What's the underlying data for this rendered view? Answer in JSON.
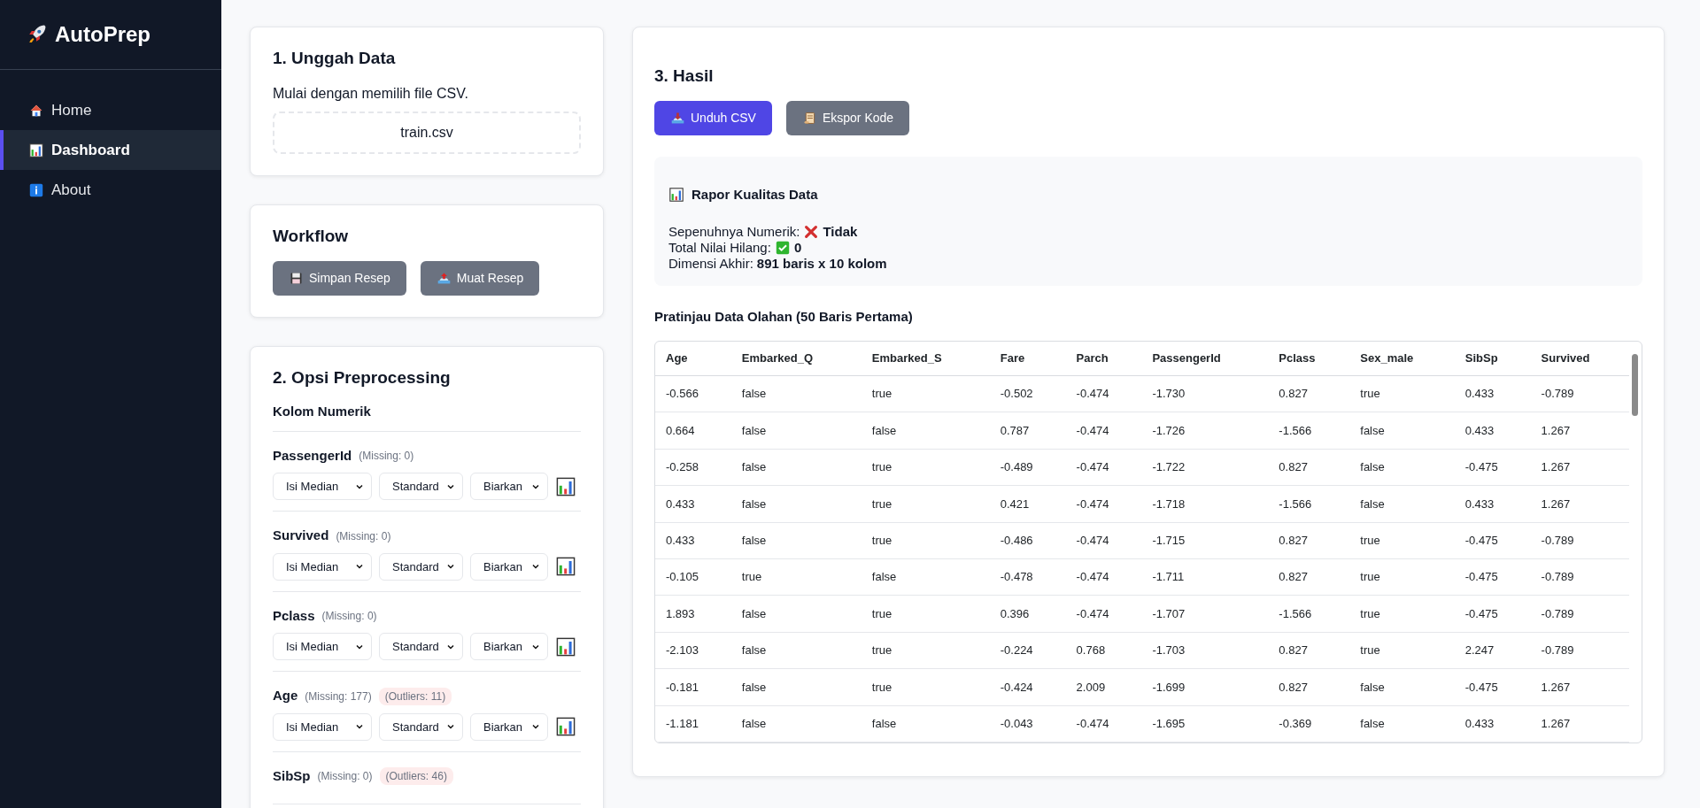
{
  "sidebar": {
    "brand": "AutoPrep",
    "items": [
      {
        "label": "Home",
        "selected": false
      },
      {
        "label": "Dashboard",
        "selected": true
      },
      {
        "label": "About",
        "selected": false
      }
    ]
  },
  "upload": {
    "title": "1. Unggah Data",
    "hint": "Mulai dengan memilih file CSV.",
    "file": "train.csv"
  },
  "workflow": {
    "title": "Workflow",
    "buttons": [
      "Simpan Resep",
      "Muat Resep"
    ]
  },
  "options": {
    "title": "2. Opsi Preprocessing",
    "section": "Kolom Numerik",
    "columns": [
      {
        "name": "PassengerId",
        "missing": "(Missing: 0)",
        "selects": [
          "Isi Median",
          "Standard",
          "Biarkan"
        ]
      },
      {
        "name": "Survived",
        "missing": "(Missing: 0)",
        "selects": [
          "Isi Median",
          "Standard",
          "Biarkan"
        ]
      },
      {
        "name": "Pclass",
        "missing": "(Missing: 0)",
        "selects": [
          "Isi Median",
          "Standard",
          "Biarkan"
        ]
      },
      {
        "name": "Age",
        "missing": "(Missing: 177)",
        "outliers": "(Outliers: 11)",
        "selects": [
          "Isi Median",
          "Standard",
          "Biarkan"
        ]
      },
      {
        "name": "SibSp",
        "missing": "(Missing: 0)",
        "outliers": "(Outliers: 46)"
      }
    ]
  },
  "results": {
    "title": "3. Hasil",
    "buttons": [
      {
        "label": "Unduh CSV",
        "kind": "primary"
      },
      {
        "label": "Ekspor Kode",
        "kind": "secondary"
      }
    ],
    "report": {
      "title": "Rapor Kualitas Data",
      "lines": [
        {
          "label": "Sepenuhnya Numerik:",
          "value": "Tidak",
          "kind": "fail"
        },
        {
          "label": "Total Nilai Hilang:",
          "value": "0",
          "kind": "pass"
        },
        {
          "label": "Dimensi Akhir:",
          "value": "891 baris x 10 kolom",
          "kind": "plain"
        }
      ]
    },
    "preview_title": "Pratinjau Data Olahan (50 Baris Pertama)",
    "table": {
      "columns": [
        "Age",
        "Embarked_Q",
        "Embarked_S",
        "Fare",
        "Parch",
        "PassengerId",
        "Pclass",
        "Sex_male",
        "SibSp",
        "Survived"
      ],
      "rows": [
        [
          "-0.566",
          "false",
          "true",
          "-0.502",
          "-0.474",
          "-1.730",
          "0.827",
          "true",
          "0.433",
          "-0.789"
        ],
        [
          "0.664",
          "false",
          "false",
          "0.787",
          "-0.474",
          "-1.726",
          "-1.566",
          "false",
          "0.433",
          "1.267"
        ],
        [
          "-0.258",
          "false",
          "true",
          "-0.489",
          "-0.474",
          "-1.722",
          "0.827",
          "false",
          "-0.475",
          "1.267"
        ],
        [
          "0.433",
          "false",
          "true",
          "0.421",
          "-0.474",
          "-1.718",
          "-1.566",
          "false",
          "0.433",
          "1.267"
        ],
        [
          "0.433",
          "false",
          "true",
          "-0.486",
          "-0.474",
          "-1.715",
          "0.827",
          "true",
          "-0.475",
          "-0.789"
        ],
        [
          "-0.105",
          "true",
          "false",
          "-0.478",
          "-0.474",
          "-1.711",
          "0.827",
          "true",
          "-0.475",
          "-0.789"
        ],
        [
          "1.893",
          "false",
          "true",
          "0.396",
          "-0.474",
          "-1.707",
          "-1.566",
          "true",
          "-0.475",
          "-0.789"
        ],
        [
          "-2.103",
          "false",
          "true",
          "-0.224",
          "0.768",
          "-1.703",
          "0.827",
          "true",
          "2.247",
          "-0.789"
        ],
        [
          "-0.181",
          "false",
          "true",
          "-0.424",
          "2.009",
          "-1.699",
          "0.827",
          "false",
          "-0.475",
          "1.267"
        ],
        [
          "-1.181",
          "false",
          "false",
          "-0.043",
          "-0.474",
          "-1.695",
          "-0.369",
          "false",
          "0.433",
          "1.267"
        ]
      ]
    }
  }
}
